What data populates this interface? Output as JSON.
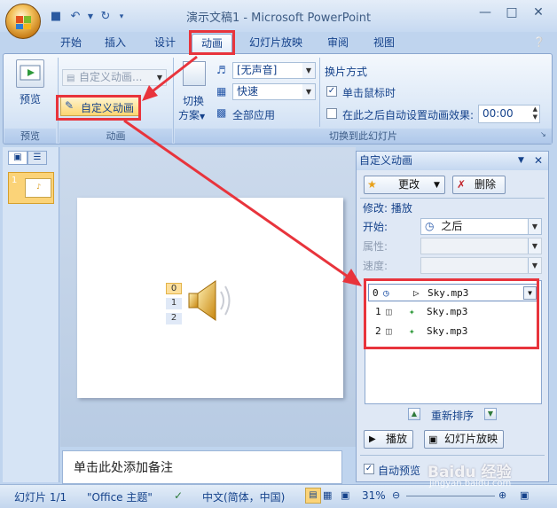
{
  "window": {
    "title": "演示文稿1 - Microsoft PowerPoint",
    "minimize_icon": "minimize-icon",
    "maximize_icon": "maximize-icon",
    "close_icon": "close-icon"
  },
  "qat": {
    "icons": [
      "save-icon",
      "undo-icon",
      "redo-icon",
      "customize-icon"
    ]
  },
  "tabs": [
    "开始",
    "插入",
    "设计",
    "动画",
    "幻灯片放映",
    "审阅",
    "视图"
  ],
  "active_tab": "动画",
  "ribbon": {
    "preview_label": "预览",
    "preview_group": "预览",
    "custom_anim_combo": "自定义动画...",
    "custom_anim_button": "自定义动画",
    "anim_group": "动画",
    "transition_scheme_label1": "切换",
    "transition_scheme_label2": "方案",
    "sound_combo": "[无声音]",
    "speed_combo": "快速",
    "apply_all": "全部应用",
    "advance_title": "换片方式",
    "on_click": "单击鼠标时",
    "auto_after": "在此之后自动设置动画效果:",
    "time_value": "00:00",
    "transition_group": "切换到此幻灯片"
  },
  "slide_thumb": {
    "number": "1"
  },
  "slide_content": {
    "anim_tags": [
      "0",
      "1",
      "2"
    ]
  },
  "notes_placeholder": "单击此处添加备注",
  "task_pane": {
    "title": "自定义动画",
    "change_button": "更改",
    "remove_button": "删除",
    "modify_label": "修改: 播放",
    "start_label": "开始:",
    "start_value": "之后",
    "property_label": "属性:",
    "speed_label": "速度:",
    "items": [
      {
        "index": "0",
        "trigger_icon": "clock-icon",
        "effect_icon": "play-icon",
        "name": "Sky.mp3"
      },
      {
        "index": "1",
        "trigger_icon": "mouse-icon",
        "effect_icon": "star-icon",
        "name": "Sky.mp3"
      },
      {
        "index": "2",
        "trigger_icon": "mouse-icon",
        "effect_icon": "star-icon",
        "name": "Sky.mp3"
      }
    ],
    "reorder_label": "重新排序",
    "play_button": "播放",
    "slideshow_button": "幻灯片放映",
    "autopreview_label": "自动预览"
  },
  "statusbar": {
    "slide_count": "幻灯片 1/1",
    "theme": "\"Office 主题\"",
    "language": "中文(简体，中国)",
    "zoom": "31%"
  },
  "watermark": {
    "text": "Baidu 经验",
    "url": "jingyan.baidu.com"
  },
  "colors": {
    "highlight": "#e8343c",
    "accent": "#15428b"
  }
}
